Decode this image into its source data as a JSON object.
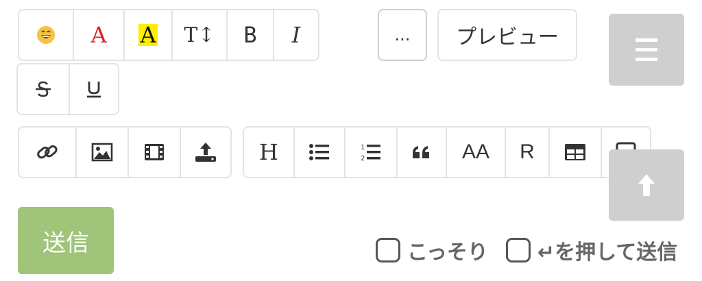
{
  "toolbar": {
    "emoji_icon": "grinning-face-icon",
    "font_color_label": "A",
    "font_color": "#e02020",
    "highlight_label": "A",
    "highlight_color": "#ffee00",
    "font_size_label": "T↕",
    "bold_label": "B",
    "italic_label": "I",
    "more_label": "...",
    "preview_label": "プレビュー",
    "heading_label": "H",
    "small_caps_label": "AA",
    "ruby_label": "R"
  },
  "submit": {
    "send_label": "送信"
  },
  "options": {
    "secret_label": "こっそり",
    "enter_send_label": "↵を押して送信"
  },
  "colors": {
    "send_bg": "#9fc47a",
    "side_button_bg": "#cfcfcf"
  }
}
